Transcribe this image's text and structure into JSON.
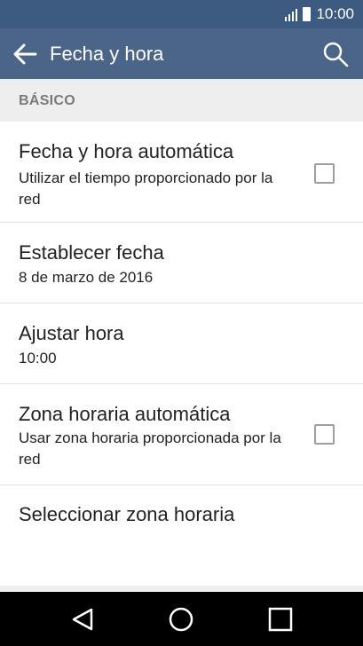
{
  "status_bar": {
    "time": "10:00",
    "signal_icon": "signal-icon",
    "battery_icon": "battery-icon"
  },
  "app_bar": {
    "title": "Fecha y hora",
    "back_icon": "back-arrow-icon",
    "search_icon": "search-icon"
  },
  "section": {
    "label": "BÁSICO"
  },
  "settings": [
    {
      "title": "Fecha y hora automática",
      "subtitle": "Utilizar el tiempo proporcionado por la red",
      "checkbox": true,
      "checked": false
    },
    {
      "title": "Establecer fecha",
      "subtitle": "8 de marzo de 2016"
    },
    {
      "title": "Ajustar hora",
      "subtitle": "10:00"
    },
    {
      "title": "Zona horaria automática",
      "subtitle": "Usar zona horaria proporcionada por la red",
      "checkbox": true,
      "checked": false
    },
    {
      "title": "Seleccionar zona horaria"
    }
  ],
  "nav_bar": {
    "back_icon": "nav-back-icon",
    "home_icon": "nav-home-icon",
    "recents_icon": "nav-recents-icon"
  },
  "colors": {
    "status_bar": "#3d5a80",
    "app_bar": "#4a6588",
    "section_bg": "#eeeeee"
  }
}
